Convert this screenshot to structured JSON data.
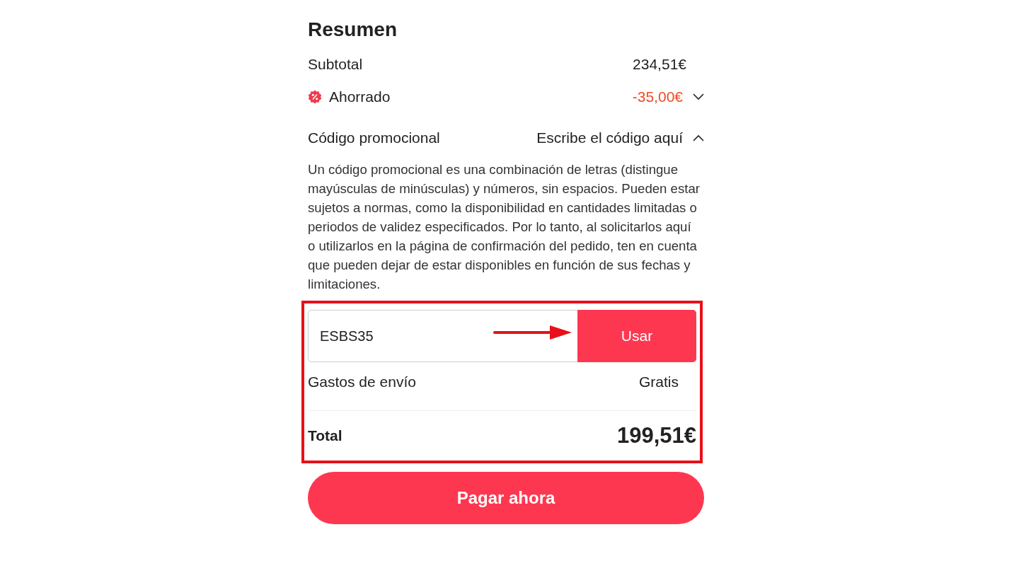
{
  "summary": {
    "title": "Resumen",
    "subtotal": {
      "label": "Subtotal",
      "value": "234,51€"
    },
    "savings": {
      "label": "Ahorrado",
      "value": "-35,00€",
      "expanded": false
    },
    "promo": {
      "label": "Código promocional",
      "action": "Escribe el código aquí",
      "expanded": true,
      "description": "Un código promocional es una combinación de letras (distingue mayúsculas de minúsculas) y números, sin espacios. Pueden estar sujetos a normas, como la disponibilidad en cantidades limitadas o periodos de validez especificados. Por lo tanto, al solicitarlos aquí o utilizarlos en la página de confirmación del pedido, ten en cuenta que pueden dejar de estar disponibles en función de sus fechas y limitaciones.",
      "code": "ESBS35",
      "apply_button": "Usar"
    },
    "shipping": {
      "label": "Gastos de envío",
      "value": "Gratis"
    },
    "total": {
      "label": "Total",
      "value": "199,51€"
    },
    "pay_button": "Pagar ahora"
  }
}
